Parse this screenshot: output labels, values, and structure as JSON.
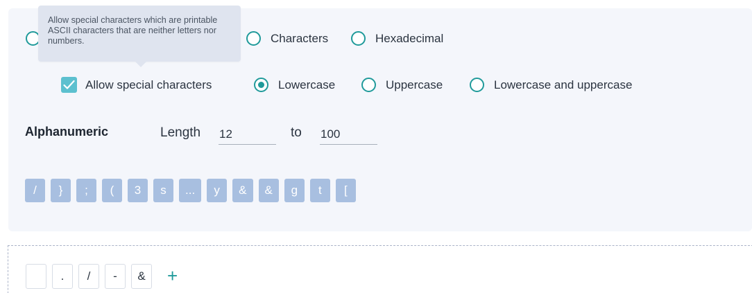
{
  "tooltip": {
    "text": "Allow special characters which are printable ASCII characters that are neither letters nor numbers."
  },
  "type_radios": [
    {
      "label": "",
      "checked": false
    },
    {
      "label": "Characters",
      "checked": false
    },
    {
      "label": "Hexadecimal",
      "checked": false
    }
  ],
  "special": {
    "label": "Allow special characters",
    "checked": true
  },
  "case_radios": [
    {
      "label": "Lowercase",
      "checked": true
    },
    {
      "label": "Uppercase",
      "checked": false
    },
    {
      "label": "Lowercase and uppercase",
      "checked": false
    }
  ],
  "alphanumeric": {
    "title": "Alphanumeric",
    "length_label": "Length",
    "min": "12",
    "to_label": "to",
    "max": "100"
  },
  "preview_chips": [
    "/",
    "}",
    ";",
    "(",
    "3",
    "s",
    "...",
    "y",
    "&",
    "&",
    "g",
    "t",
    "["
  ],
  "char_set": [
    "",
    ".",
    "/",
    "-",
    "&"
  ],
  "add_symbol": "+",
  "colors": {
    "accent": "#1f9a9a",
    "chip": "#a8bfe0",
    "panel": "#f4f6fb",
    "checkbox": "#5cc0cf"
  }
}
